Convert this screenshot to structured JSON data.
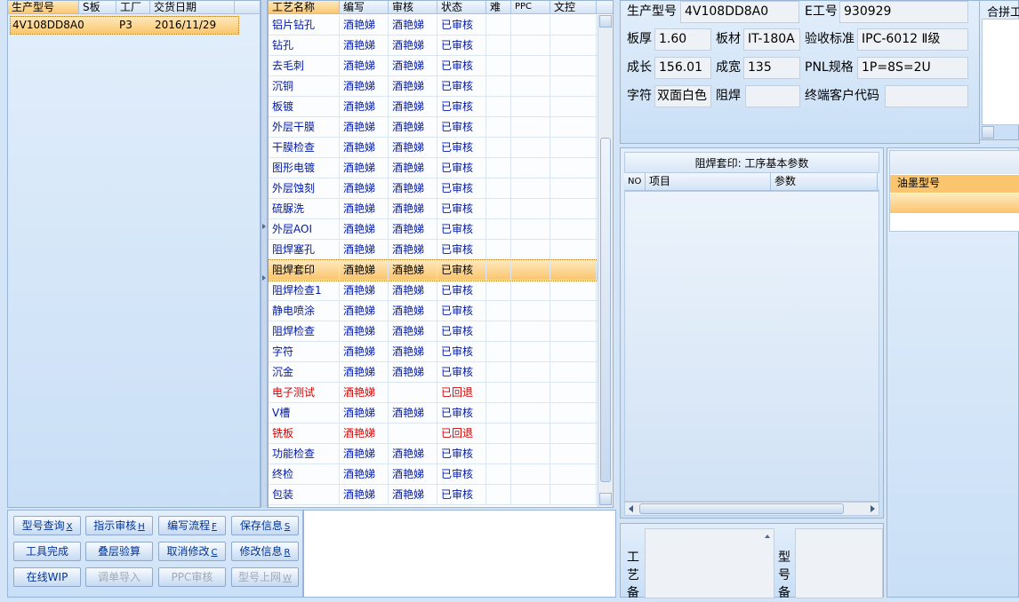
{
  "model_grid": {
    "headers": [
      "生产型号",
      "S板",
      "工厂",
      "交货日期"
    ],
    "row": {
      "model": "4V108DD8A0",
      "factory": "P3",
      "date": "2016/11/29"
    }
  },
  "process_grid": {
    "headers": [
      "工艺名称",
      "编写",
      "审核",
      "状态",
      "难",
      "PPC",
      "文控"
    ],
    "rows": [
      {
        "name": "铝片钻孔",
        "author": "酒艳娣",
        "reviewer": "酒艳娣",
        "status": "已审核"
      },
      {
        "name": "钻孔",
        "author": "酒艳娣",
        "reviewer": "酒艳娣",
        "status": "已审核"
      },
      {
        "name": "去毛刺",
        "author": "酒艳娣",
        "reviewer": "酒艳娣",
        "status": "已审核"
      },
      {
        "name": "沉铜",
        "author": "酒艳娣",
        "reviewer": "酒艳娣",
        "status": "已审核"
      },
      {
        "name": "板镀",
        "author": "酒艳娣",
        "reviewer": "酒艳娣",
        "status": "已审核"
      },
      {
        "name": "外层干膜",
        "author": "酒艳娣",
        "reviewer": "酒艳娣",
        "status": "已审核"
      },
      {
        "name": "干膜检查",
        "author": "酒艳娣",
        "reviewer": "酒艳娣",
        "status": "已审核"
      },
      {
        "name": "图形电镀",
        "author": "酒艳娣",
        "reviewer": "酒艳娣",
        "status": "已审核"
      },
      {
        "name": "外层蚀刻",
        "author": "酒艳娣",
        "reviewer": "酒艳娣",
        "status": "已审核"
      },
      {
        "name": "硫脲洗",
        "author": "酒艳娣",
        "reviewer": "酒艳娣",
        "status": "已审核"
      },
      {
        "name": "外层AOI",
        "author": "酒艳娣",
        "reviewer": "酒艳娣",
        "status": "已审核"
      },
      {
        "name": "阻焊塞孔",
        "author": "酒艳娣",
        "reviewer": "酒艳娣",
        "status": "已审核"
      },
      {
        "name": "阻焊套印",
        "author": "酒艳娣",
        "reviewer": "酒艳娣",
        "status": "已审核",
        "selected": true
      },
      {
        "name": "阻焊检查1",
        "author": "酒艳娣",
        "reviewer": "酒艳娣",
        "status": "已审核"
      },
      {
        "name": "静电喷涂",
        "author": "酒艳娣",
        "reviewer": "酒艳娣",
        "status": "已审核"
      },
      {
        "name": "阻焊检查",
        "author": "酒艳娣",
        "reviewer": "酒艳娣",
        "status": "已审核"
      },
      {
        "name": "字符",
        "author": "酒艳娣",
        "reviewer": "酒艳娣",
        "status": "已审核"
      },
      {
        "name": "沉金",
        "author": "酒艳娣",
        "reviewer": "酒艳娣",
        "status": "已审核"
      },
      {
        "name": "电子测试",
        "author": "酒艳娣",
        "reviewer": "",
        "status": "已回退",
        "returned": true
      },
      {
        "name": "V槽",
        "author": "酒艳娣",
        "reviewer": "酒艳娣",
        "status": "已审核"
      },
      {
        "name": "铣板",
        "author": "酒艳娣",
        "reviewer": "",
        "status": "已回退",
        "returned": true
      },
      {
        "name": "功能检查",
        "author": "酒艳娣",
        "reviewer": "酒艳娣",
        "status": "已审核"
      },
      {
        "name": "终检",
        "author": "酒艳娣",
        "reviewer": "酒艳娣",
        "status": "已审核"
      },
      {
        "name": "包装",
        "author": "酒艳娣",
        "reviewer": "酒艳娣",
        "status": "已审核"
      }
    ]
  },
  "info": {
    "model_label": "生产型号",
    "model_value": "4V108DD8A0",
    "eng_label": "E工号",
    "eng_value": "930929",
    "thickness_label": "板厚",
    "thickness_value": "1.60",
    "material_label": "板材",
    "material_value": "IT-180A",
    "standard_label": "验收标准",
    "standard_value": "IPC-6012 Ⅱ级",
    "length_label": "成长",
    "length_value": "156.01",
    "width_label": "成宽",
    "width_value": "135",
    "pnl_label": "PNL规格",
    "pnl_value": "1P=8S=2U",
    "char_label": "字符",
    "char_value": "双面白色",
    "mask_label": "阻焊",
    "mask_value": "",
    "customer_label": "终端客户代码",
    "customer_value": "",
    "partial_label": "合拼工"
  },
  "params_panel": {
    "title": "阻焊套印: 工序基本参数",
    "col_no": "NO",
    "col_item": "项目",
    "col_param": "参数"
  },
  "ink_panel": {
    "header": "油墨型号"
  },
  "remarks": {
    "process_label": "工艺备",
    "model_label": "型号备"
  },
  "buttons": [
    {
      "label": "型号查询",
      "key": "X",
      "enabled": true
    },
    {
      "label": "指示审核",
      "key": "H",
      "enabled": true
    },
    {
      "label": "编写流程",
      "key": "F",
      "enabled": true
    },
    {
      "label": "保存信息",
      "key": "S",
      "enabled": true
    },
    {
      "label": "工具完成",
      "key": "",
      "enabled": true
    },
    {
      "label": "叠层验算",
      "key": "",
      "enabled": true
    },
    {
      "label": "取消修改",
      "key": "C",
      "enabled": true
    },
    {
      "label": "修改信息",
      "key": "R",
      "enabled": true
    },
    {
      "label": "在线WIP",
      "key": "",
      "enabled": true
    },
    {
      "label": "调单导入",
      "key": "",
      "enabled": false
    },
    {
      "label": "PPC审核",
      "key": "",
      "enabled": false
    },
    {
      "label": "型号上网",
      "key": "W",
      "enabled": false
    }
  ],
  "colors": {
    "selection": "#fbc56e",
    "returned": "#d80000",
    "link_text": "#0018a8"
  }
}
